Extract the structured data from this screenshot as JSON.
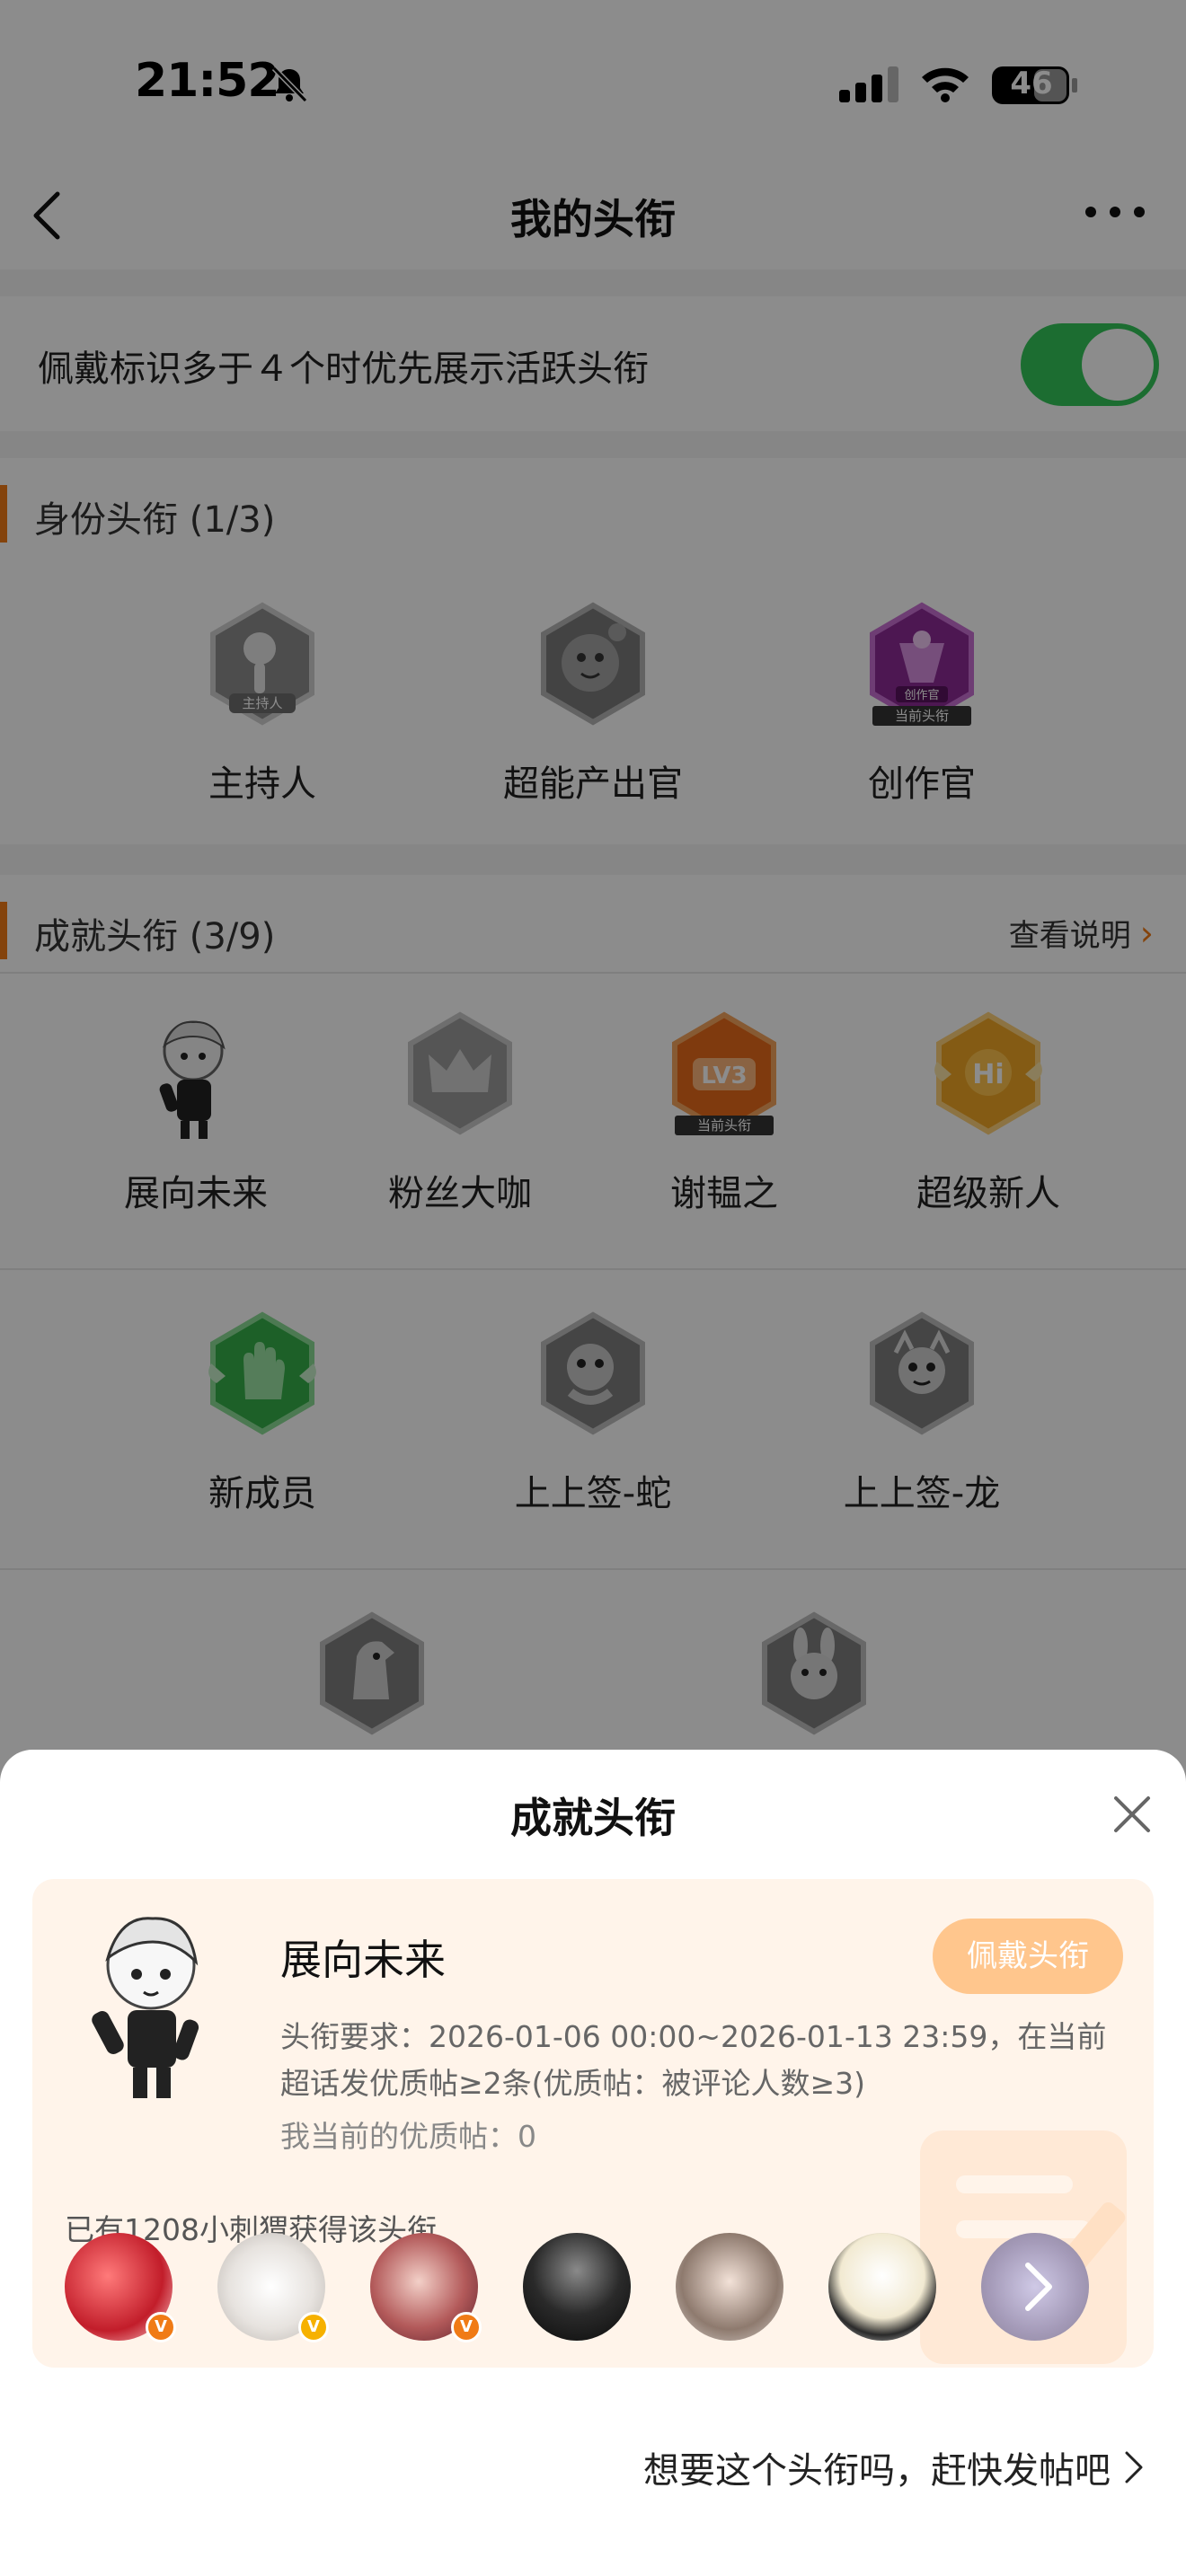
{
  "status_bar": {
    "time": "21:52",
    "battery": "46"
  },
  "nav": {
    "title": "我的头衔"
  },
  "toggle": {
    "label": "佩戴标识多于４个时优先展示活跃头衔",
    "on": true
  },
  "identity_section": {
    "title": "身份头衔 (1/3)",
    "badges": [
      {
        "name": "主持人",
        "tag": "主持人",
        "icon": "microphone-icon"
      },
      {
        "name": "超能产出官",
        "tag": "",
        "icon": "mascot-icon"
      },
      {
        "name": "创作官",
        "tag": "创作官",
        "current": "当前头衔",
        "icon": "creator-icon"
      }
    ]
  },
  "achievement_section": {
    "title": "成就头衔 (3/9)",
    "explain": "查看说明",
    "badges": [
      {
        "name": "展向未来",
        "icon": "character-icon"
      },
      {
        "name": "粉丝大咖",
        "icon": "crown-icon"
      },
      {
        "name": "谢韫之",
        "tag": "LV3",
        "current": "当前头衔",
        "icon": "lv3-icon"
      },
      {
        "name": "超级新人",
        "tag": "Hi",
        "icon": "hi-wings-icon"
      },
      {
        "name": "新成员",
        "icon": "hand-icon"
      },
      {
        "name": "上上签-蛇",
        "icon": "snake-icon"
      },
      {
        "name": "上上签-龙",
        "icon": "dragon-icon"
      },
      {
        "name": "",
        "icon": "horse-icon"
      },
      {
        "name": "",
        "icon": "rabbit-icon"
      }
    ]
  },
  "sheet": {
    "title": "成就头衔",
    "badge_title": "展向未来",
    "wear_button": "佩戴头衔",
    "requirement": "头衔要求：2026-01-06 00:00~2026-01-13 23:59，在当前超话发优质帖≥2条(优质帖：被评论人数≥3)",
    "my_posts": "我当前的优质帖：0",
    "owners": "已有1208小刺猬获得该头衔",
    "cta": "想要这个头衔吗，赶快发帖吧"
  },
  "colors": {
    "accent": "#f07b16",
    "toggle_on": "#34c759",
    "wear_button": "#ffc68d",
    "sheet_card": "#fff4ea"
  }
}
